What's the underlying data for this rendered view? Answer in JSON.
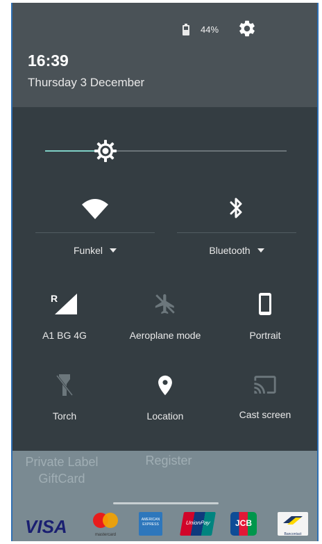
{
  "status": {
    "battery_percent": "44%",
    "time": "16:39",
    "date": "Thursday 3 December"
  },
  "brightness": {
    "level": 0.25
  },
  "tiles": {
    "wifi": {
      "label": "Funkel",
      "icon": "wifi-icon"
    },
    "bluetooth": {
      "label": "Bluetooth",
      "icon": "bluetooth-icon"
    },
    "mobile": {
      "label": "A1 BG 4G",
      "icon": "signal-icon",
      "roaming": "R"
    },
    "aeroplane": {
      "label": "Aeroplane mode",
      "icon": "airplane-icon"
    },
    "rotation": {
      "label": "Portrait",
      "icon": "phone-portrait-icon"
    },
    "torch": {
      "label": "Torch",
      "icon": "flashlight-icon"
    },
    "location": {
      "label": "Location",
      "icon": "location-pin-icon"
    },
    "cast": {
      "label": "Cast screen",
      "icon": "cast-icon"
    }
  },
  "background": {
    "private_label": "Private Label\nGiftCard",
    "register": "Register",
    "cards": {
      "visa": "VISA",
      "mastercard": "mastercard",
      "amex": "AMERICAN EXPRESS",
      "unionpay": "UnionPay",
      "jcb": "JCB",
      "bancontact": "Bancontact"
    }
  },
  "colors": {
    "accent": "#7fd0c6",
    "panel_bg": "#343d42",
    "status_bg": "#4a5257"
  }
}
